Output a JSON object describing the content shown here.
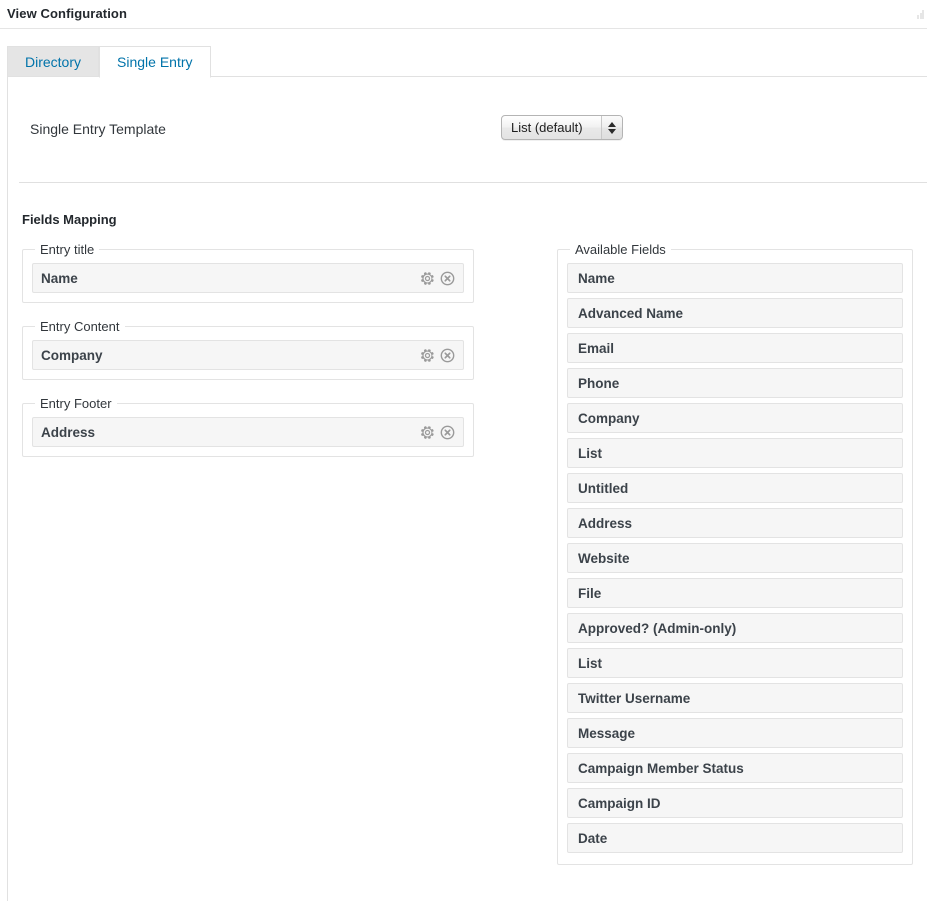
{
  "header": {
    "title": "View Configuration",
    "corner_icon": "resize-handle-icon"
  },
  "tabs": [
    {
      "label": "Directory",
      "active": false,
      "name": "tab-directory"
    },
    {
      "label": "Single Entry",
      "active": true,
      "name": "tab-single-entry"
    }
  ],
  "template_section": {
    "label": "Single Entry Template",
    "select": {
      "selected": "List (default)",
      "options": [
        "List (default)"
      ]
    }
  },
  "fields_mapping": {
    "title": "Fields Mapping",
    "zones": [
      {
        "legend": "Entry title",
        "field": {
          "label": "Name",
          "gear_icon": "gear-icon",
          "remove_icon": "remove-circle-icon"
        }
      },
      {
        "legend": "Entry Content",
        "field": {
          "label": "Company",
          "gear_icon": "gear-icon",
          "remove_icon": "remove-circle-icon"
        }
      },
      {
        "legend": "Entry Footer",
        "field": {
          "label": "Address",
          "gear_icon": "gear-icon",
          "remove_icon": "remove-circle-icon"
        }
      }
    ]
  },
  "available_fields": {
    "legend": "Available Fields",
    "items": [
      "Name",
      "Advanced Name",
      "Email",
      "Phone",
      "Company",
      "List",
      "Untitled",
      "Address",
      "Website",
      "File",
      "Approved? (Admin-only)",
      "List",
      "Twitter Username",
      "Message",
      "Campaign Member Status",
      "Campaign ID",
      "Date"
    ]
  },
  "colors": {
    "link": "#0073aa",
    "text": "#32373c",
    "heading": "#23282d",
    "border": "#e3e3e3",
    "row_bg": "#f6f6f6",
    "tab_inactive_bg": "#e5e5e5",
    "icon_gray": "#9a9a9a"
  }
}
